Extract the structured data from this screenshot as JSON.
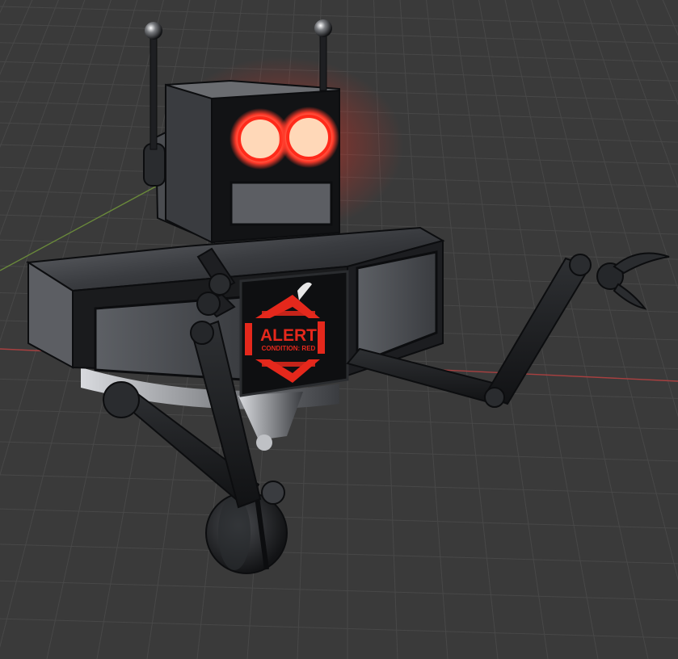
{
  "scene": {
    "screen": {
      "line1": "ALERT",
      "line2": "CONDITION: RED"
    }
  },
  "colors": {
    "background": "#3a3a3a",
    "grid_line": "#484848",
    "axis_x": "#b04040",
    "axis_y": "#6a8a3a",
    "metal_dark": "#1a1b1d",
    "metal_light": "#5a5c60",
    "eye_glow": "#ff3a2a",
    "eye_core": "#ffd8b0",
    "screen_red": "#e5281c"
  },
  "icons": [
    "robot-head",
    "antenna-left",
    "antenna-right",
    "eye-left",
    "eye-right",
    "chest-screen",
    "left-arm",
    "right-arm",
    "claw",
    "wheel"
  ]
}
